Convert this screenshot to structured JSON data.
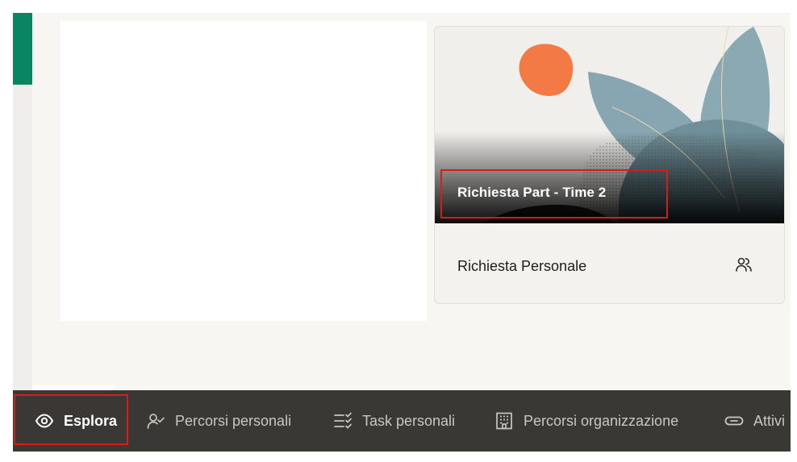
{
  "card": {
    "title": "Richiesta Part - Time 2",
    "subtitle": "Richiesta Personale",
    "icon": "people-icon"
  },
  "tabs": [
    {
      "label": "Esplora",
      "icon": "eye-icon",
      "active": true
    },
    {
      "label": "Percorsi personali",
      "icon": "person-check-icon",
      "active": false
    },
    {
      "label": "Task personali",
      "icon": "checklist-icon",
      "active": false
    },
    {
      "label": "Percorsi organizzazione",
      "icon": "building-icon",
      "active": false
    },
    {
      "label": "Attivi",
      "icon": "pill-icon",
      "active": false
    }
  ],
  "colors": {
    "accent_green": "#0a8562",
    "highlight_red": "#d81c1c",
    "tabbar_bg": "#3a3835"
  }
}
